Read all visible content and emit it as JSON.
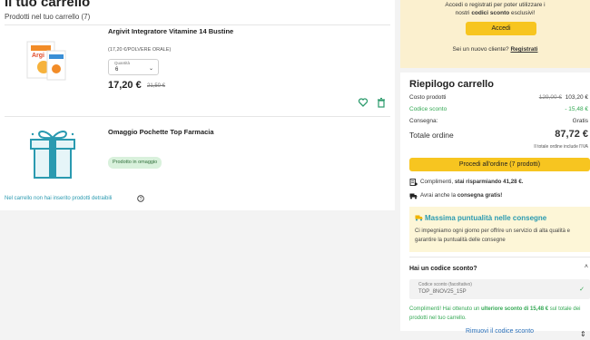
{
  "cart": {
    "title": "Il tuo carrello",
    "subtitle": "Prodotti nel tuo carrello (7)",
    "items": [
      {
        "name": "Argivit Integratore Vitamine 14 Bustine",
        "sub": "(17,20 €/POLVERE ORALE)",
        "qty_label": "Quantità",
        "qty_value": "6",
        "price": "17,20 €",
        "price_old": "21,50 €"
      },
      {
        "name": "Omaggio Pochette Top Farmacia",
        "badge": "Prodotto in omaggio"
      }
    ],
    "note": "Nel carrello non hai inserito prodotti detraibili"
  },
  "login": {
    "line1": "Accedi o registrati per poter utilizzare i",
    "line2_prefix": "nostri",
    "line2_bold": "codici sconto",
    "line2_suffix": "esclusivi!",
    "button": "Accedi",
    "new_prefix": "Sei un nuovo cliente?",
    "new_link": "Registrati"
  },
  "summary": {
    "title": "Riepilogo carrello",
    "rows": [
      {
        "label": "Costo prodotti",
        "old": "129,00 €",
        "value": "103,20 €"
      },
      {
        "label": "Codice sconto",
        "value": "- 15,48 €"
      },
      {
        "label": "Consegna:",
        "value": "Gratis"
      }
    ],
    "total_label": "Totale ordine",
    "total_value": "87,72 €",
    "vat_note": "Il totale ordine include l'IVA",
    "checkout": "Procedi all'ordine (7 prodotti)",
    "perk1_prefix": "Complimenti,",
    "perk1_bold": "stai risparmiando 41,28 €.",
    "perk2_prefix": "Avrai anche la",
    "perk2_bold": "consegna gratis!",
    "promo_title": "Massima puntualità nelle consegne",
    "promo_text": "Ci impegniamo ogni giorno per offrire un servizio di alta qualità e garantire la puntualità delle consegne",
    "coupon_title": "Hai un codice sconto?",
    "coupon_label": "Codice sconto (facoltativo)",
    "coupon_value": "TOP_8NOV25_15P",
    "coupon_msg_prefix": "Complimenti! Hai ottenuto un",
    "coupon_msg_bold": "ulteriore sconto di 15,48 €",
    "coupon_msg_suffix": "sul totale dei prodotti nel tuo carrello.",
    "coupon_remove": "Rimuovi il codice sconto"
  }
}
